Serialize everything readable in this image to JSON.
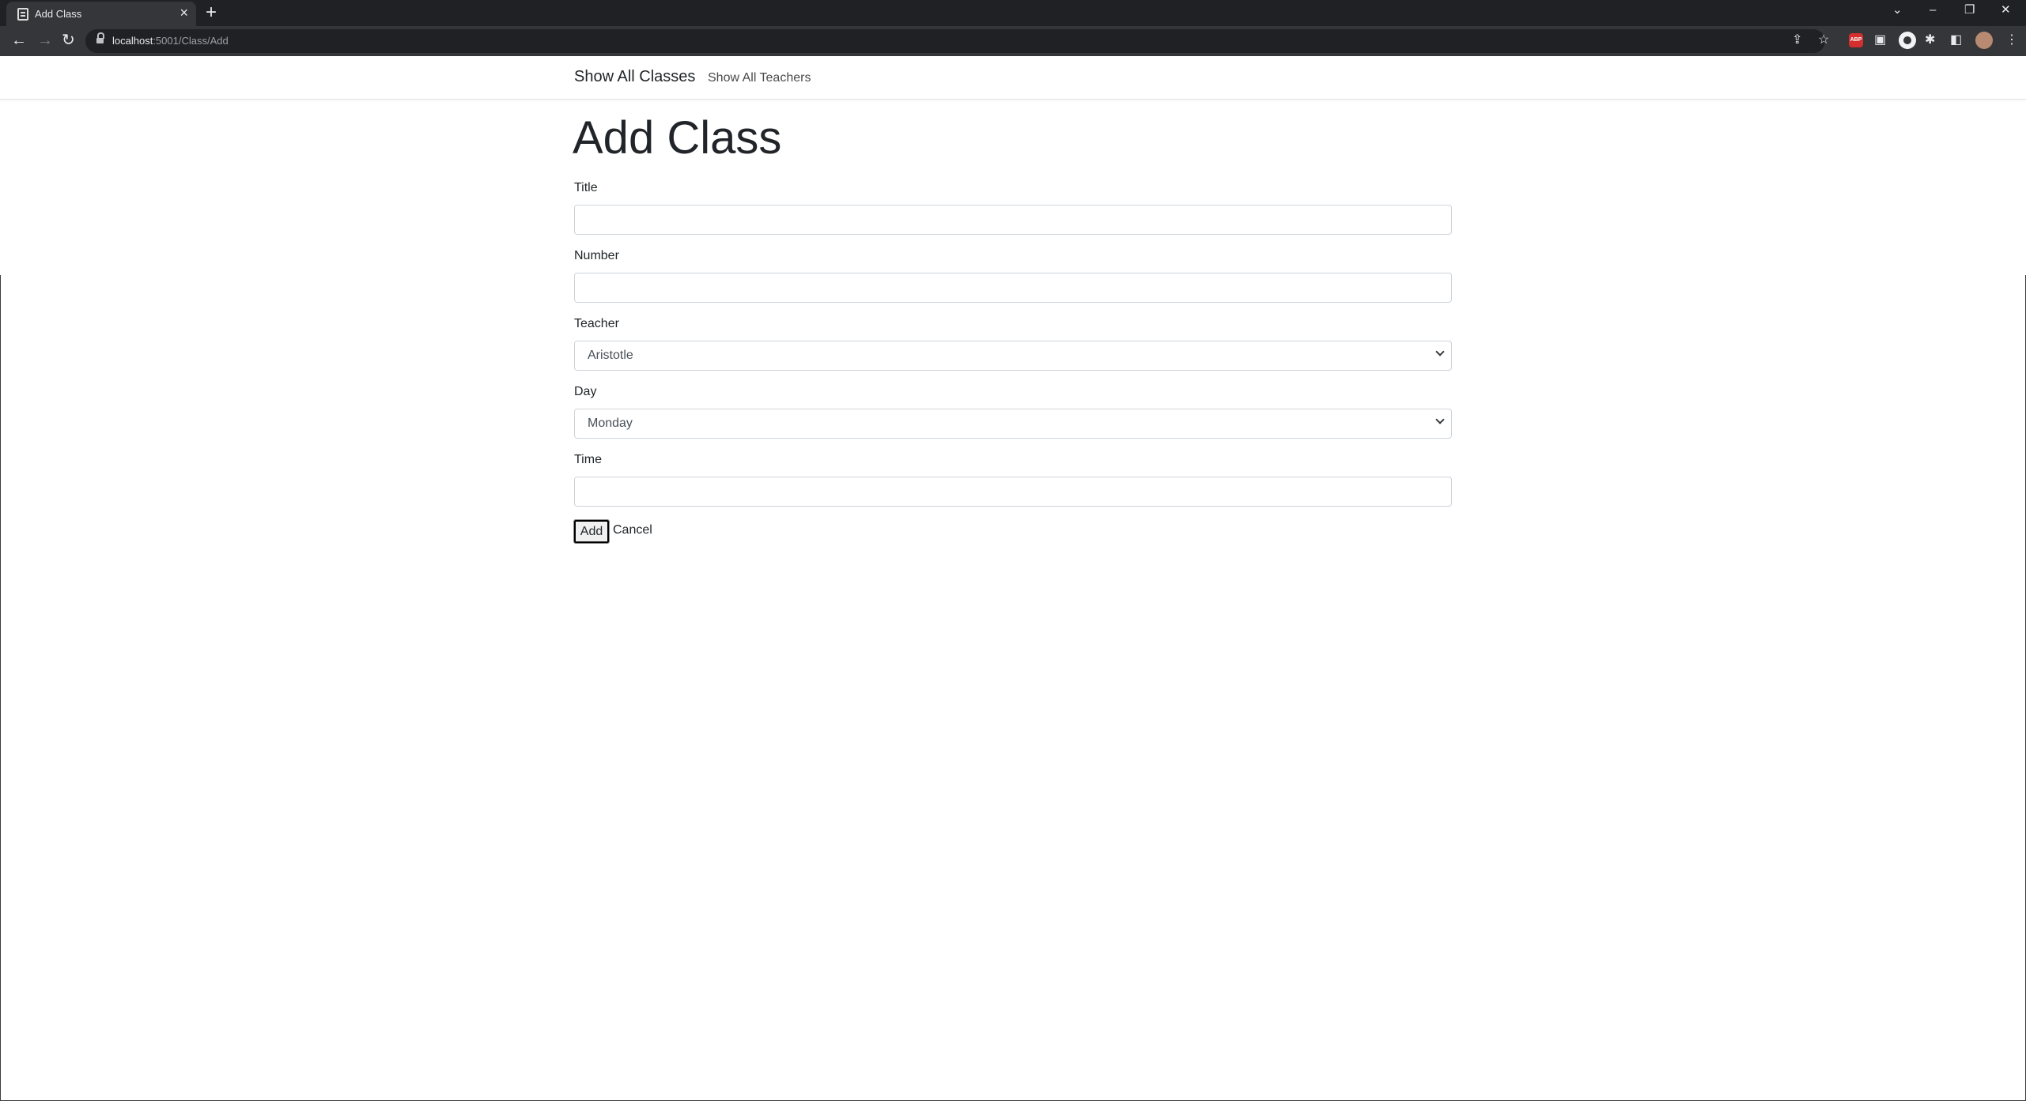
{
  "browser": {
    "tab_title": "Add Class",
    "new_tab_symbol": "+",
    "url_host": "localhost",
    "url_path": ":5001/Class/Add",
    "extension_badge": "ABP"
  },
  "nav": {
    "brand": "Show All Classes",
    "link": "Show All Teachers"
  },
  "page": {
    "heading": "Add Class",
    "fields": {
      "title_label": "Title",
      "title_value": "",
      "number_label": "Number",
      "number_value": "",
      "teacher_label": "Teacher",
      "teacher_selected": "Aristotle",
      "day_label": "Day",
      "day_selected": "Monday",
      "time_label": "Time",
      "time_value": ""
    },
    "add_button": "Add",
    "cancel_link": "Cancel"
  },
  "icons": {
    "tab": "page-icon",
    "back": "back-arrow-icon",
    "forward": "forward-arrow-icon",
    "reload": "reload-icon",
    "secure": "lock-icon",
    "share": "share-icon",
    "bookmark": "star-icon",
    "extensions": "puzzle-icon",
    "side_panel": "side-panel-icon",
    "menu": "kebab-menu-icon"
  }
}
